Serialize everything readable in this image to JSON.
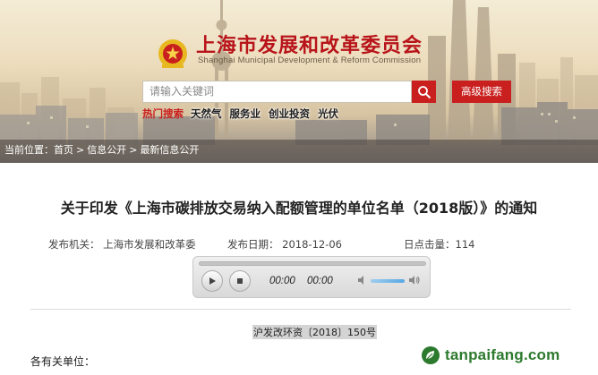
{
  "header": {
    "site_title": "上海市发展和改革委员会",
    "site_subtitle": "Shanghai Municipal Development & Reform Commission",
    "search_placeholder": "请输入关键词",
    "advanced_search_label": "高级搜索",
    "hot_label": "热门搜索",
    "hot_keywords": [
      "天然气",
      "服务业",
      "创业投资",
      "光伏"
    ]
  },
  "breadcrumb": {
    "prefix": "当前位置：",
    "items": [
      "首页",
      "信息公开",
      "最新信息公开"
    ],
    "separator": ">"
  },
  "article": {
    "title": "关于印发《上海市碳排放交易纳入配额管理的单位名单（2018版）》的通知",
    "publisher_label": "发布机关：",
    "publisher": "上海市发展和改革委",
    "date_label": "发布日期：",
    "date": "2018-12-06",
    "clicks_label": "日点击量：",
    "clicks": "114",
    "doc_number": "沪发改环资〔2018〕150号",
    "salutation": "各有关单位："
  },
  "audio_player": {
    "current_time": "00:00",
    "duration": "00:00",
    "icons": [
      "play-icon",
      "stop-icon",
      "volume-mute-icon",
      "volume-max-icon"
    ]
  },
  "watermark": {
    "text": "tanpaifang.com",
    "icon": "leaf-logo-icon",
    "color": "#2c7a2d"
  },
  "colors": {
    "accent_red": "#c9201f",
    "title_red": "#b8141a"
  }
}
